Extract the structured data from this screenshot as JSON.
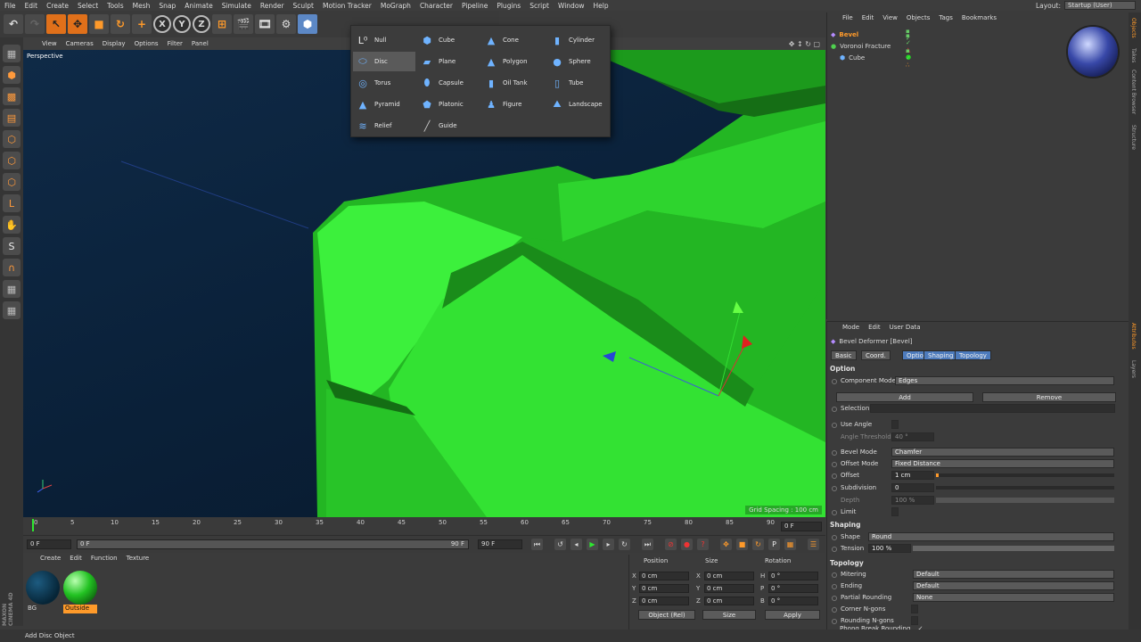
{
  "menubar": {
    "items": [
      "File",
      "Edit",
      "Create",
      "Select",
      "Tools",
      "Mesh",
      "Snap",
      "Animate",
      "Simulate",
      "Render",
      "Sculpt",
      "Motion Tracker",
      "MoGraph",
      "Character",
      "Pipeline",
      "Plugins",
      "Script",
      "Window",
      "Help"
    ],
    "layout_label": "Layout:",
    "layout_value": "Startup (User)"
  },
  "toolbar": {
    "axis_x": "X",
    "axis_y": "Y",
    "axis_z": "Z"
  },
  "viewport": {
    "menu": [
      "View",
      "Cameras",
      "Display",
      "Options",
      "Filter",
      "Panel"
    ],
    "label": "Perspective",
    "grid_spacing": "Grid Spacing : 100 cm",
    "accent": "#2ee830"
  },
  "popup": {
    "items": [
      {
        "label": "Null",
        "icon": "null-icon"
      },
      {
        "label": "Cube",
        "icon": "cube-icon"
      },
      {
        "label": "Cone",
        "icon": "cone-icon"
      },
      {
        "label": "Cylinder",
        "icon": "cylinder-icon"
      },
      {
        "label": "Disc",
        "icon": "disc-icon"
      },
      {
        "label": "Plane",
        "icon": "plane-icon"
      },
      {
        "label": "Polygon",
        "icon": "polygon-icon"
      },
      {
        "label": "Sphere",
        "icon": "sphere-icon"
      },
      {
        "label": "Torus",
        "icon": "torus-icon"
      },
      {
        "label": "Capsule",
        "icon": "capsule-icon"
      },
      {
        "label": "Oil Tank",
        "icon": "oil-tank-icon"
      },
      {
        "label": "Tube",
        "icon": "tube-icon"
      },
      {
        "label": "Pyramid",
        "icon": "pyramid-icon"
      },
      {
        "label": "Platonic",
        "icon": "platonic-icon"
      },
      {
        "label": "Figure",
        "icon": "figure-icon"
      },
      {
        "label": "Landscape",
        "icon": "landscape-icon"
      },
      {
        "label": "Relief",
        "icon": "relief-icon"
      },
      {
        "label": "Guide",
        "icon": "guide-icon"
      }
    ],
    "selected": "Disc"
  },
  "timeline": {
    "ticks": [
      "0",
      "5",
      "10",
      "15",
      "20",
      "25",
      "30",
      "35",
      "40",
      "45",
      "50",
      "55",
      "60",
      "65",
      "70",
      "75",
      "80",
      "85",
      "90"
    ],
    "current_frame_field": "0 F"
  },
  "playbar": {
    "start": "0 F",
    "range_start": "0 F",
    "range_end": "90 F",
    "end": "90 F"
  },
  "materials": {
    "menu": [
      "Create",
      "Edit",
      "Function",
      "Texture"
    ],
    "items": [
      {
        "label": "BG",
        "color": "#0b3550"
      },
      {
        "label": "Outside",
        "color": "#22c222"
      }
    ]
  },
  "coords": {
    "headers": [
      "Position",
      "Size",
      "Rotation"
    ],
    "rows": [
      {
        "axis": "X",
        "pos": "0 cm",
        "size_axis": "X",
        "size": "0 cm",
        "rot_axis": "H",
        "rot": "0 °"
      },
      {
        "axis": "Y",
        "pos": "0 cm",
        "size_axis": "Y",
        "size": "0 cm",
        "rot_axis": "P",
        "rot": "0 °"
      },
      {
        "axis": "Z",
        "pos": "0 cm",
        "size_axis": "Z",
        "size": "0 cm",
        "rot_axis": "B",
        "rot": "0 °"
      }
    ],
    "mode": "Object (Rel)",
    "size_mode": "Size",
    "apply": "Apply"
  },
  "objects": {
    "menu": [
      "File",
      "Edit",
      "View",
      "Objects",
      "Tags",
      "Bookmarks"
    ],
    "items": [
      {
        "label": "Bevel",
        "color": "#ff9a2a"
      },
      {
        "label": "Voronoi Fracture",
        "color": "#dddddd"
      },
      {
        "label": "Cube",
        "color": "#dddddd"
      }
    ]
  },
  "attributes": {
    "menu": [
      "Mode",
      "Edit",
      "User Data"
    ],
    "title": "Bevel Deformer [Bevel]",
    "tabs": [
      "Basic",
      "Coord.",
      "Option",
      "Shaping",
      "Topology"
    ],
    "option_title": "Option",
    "component_mode_label": "Component Mode",
    "component_mode_value": "Edges",
    "add": "Add",
    "remove": "Remove",
    "selection_label": "Selection",
    "use_angle_label": "Use Angle",
    "angle_threshold_label": "Angle Threshold",
    "angle_threshold_value": "40 °",
    "bevel_mode_label": "Bevel Mode",
    "bevel_mode_value": "Chamfer",
    "offset_mode_label": "Offset Mode",
    "offset_mode_value": "Fixed Distance",
    "offset_label": "Offset",
    "offset_value": "1 cm",
    "subdivision_label": "Subdivision",
    "subdivision_value": "0",
    "depth_label": "Depth",
    "depth_value": "100 %",
    "limit_label": "Limit",
    "shaping_title": "Shaping",
    "shape_label": "Shape",
    "shape_value": "Round",
    "tension_label": "Tension",
    "tension_value": "100 %",
    "topology_title": "Topology",
    "mitering_label": "Mitering",
    "mitering_value": "Default",
    "ending_label": "Ending",
    "ending_value": "Default",
    "partial_rounding_label": "Partial Rounding",
    "partial_rounding_value": "None",
    "corner_ngons_label": "Corner N-gons",
    "rounding_ngons_label": "Rounding N-gons",
    "phong_break_label": "Phong Break Rounding",
    "phong_break_check": "✓"
  },
  "right_tabs": [
    "Objects",
    "Takes",
    "Content Browser",
    "Structure",
    "Attributes",
    "Layers"
  ],
  "status": "Add Disc Object",
  "brand": "MAXON CINEMA 4D"
}
